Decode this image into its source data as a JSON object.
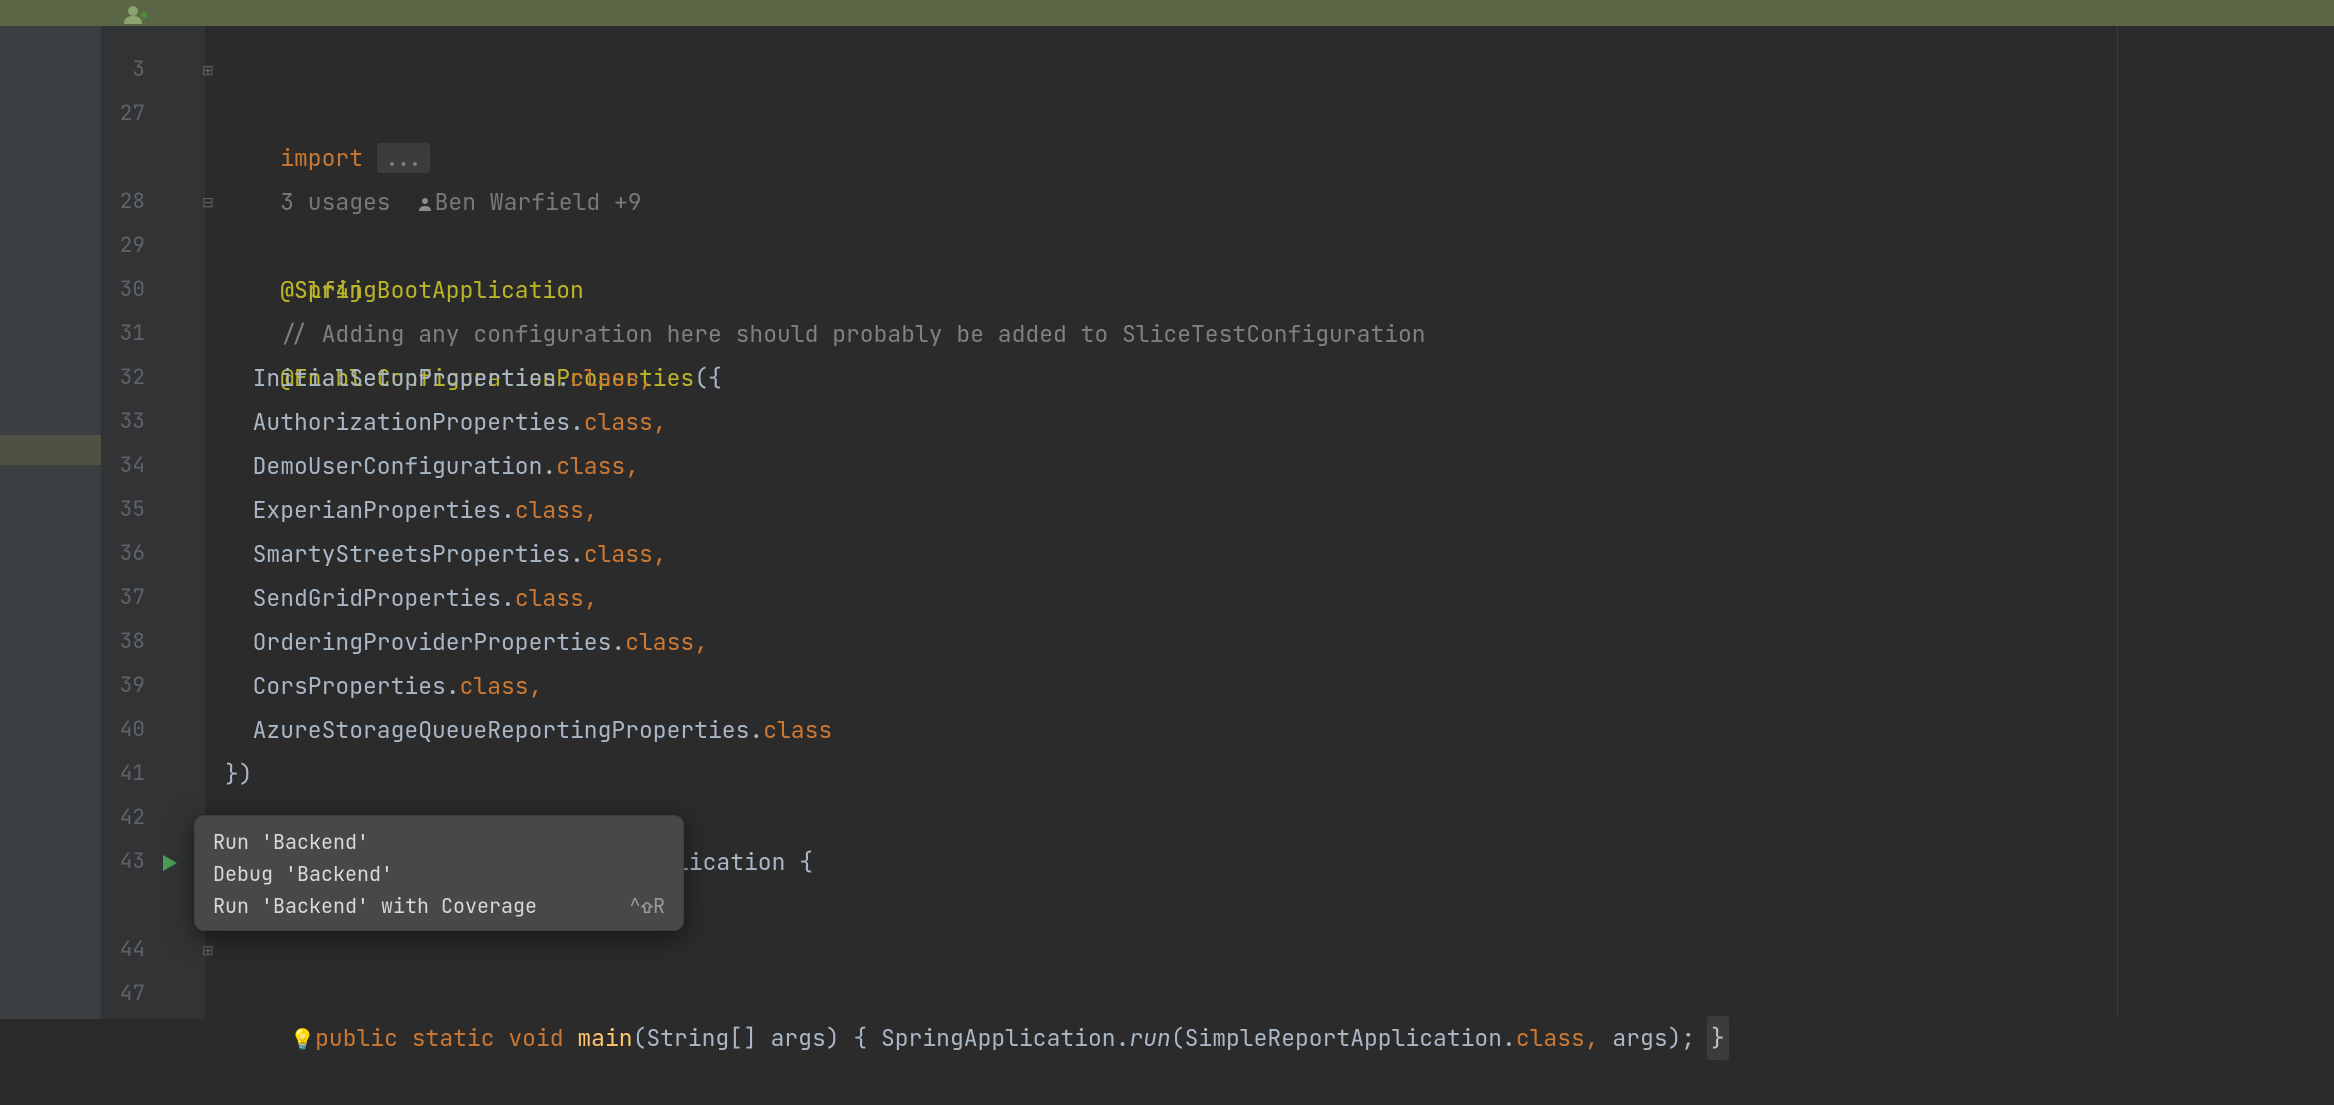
{
  "toolbar": {
    "avatar_icon": "avatar"
  },
  "gutter": {
    "line_numbers": [
      "3",
      "27",
      "28",
      "29",
      "30",
      "31",
      "32",
      "33",
      "34",
      "35",
      "36",
      "37",
      "38",
      "39",
      "40",
      "41",
      "42",
      "43",
      "44",
      "47"
    ]
  },
  "lens": {
    "usages": "3 usages",
    "author": "Ben Warfield +9"
  },
  "code": {
    "l3_import": "import",
    "l3_ellipsis": "...",
    "l28": "@Slf4j",
    "l29": "@SpringBootApplication",
    "l30": "// Adding any configuration here should probably be added to SliceTestConfiguration",
    "l31a": "@EnableConfigurationProperties",
    "l31b": "({",
    "l32a": "  InitialSetupProperties.",
    "l32b": "class,",
    "l33a": "  AuthorizationProperties.",
    "l33b": "class,",
    "l34a": "  DemoUserConfiguration.",
    "l34b": "class,",
    "l35a": "  ExperianProperties.",
    "l35b": "class,",
    "l36a": "  SmartyStreetsProperties.",
    "l36b": "class,",
    "l37a": "  SendGridProperties.",
    "l37b": "class,",
    "l38a": "  OrderingProviderProperties.",
    "l38b": "class,",
    "l39a": "  CorsProperties.",
    "l39b": "class,",
    "l40a": "  AzureStorageQueueReportingProperties.",
    "l40b": "class",
    "l41": "})",
    "l43_tail": "lication {",
    "l44_public": "public",
    "l44_static": "static",
    "l44_void": "void",
    "l44_main": "main",
    "l44_args": "(String[] args) { SpringApplication.",
    "l44_run": "run",
    "l44_paren_open": "(",
    "l44_cls": "SimpleReportApplication.",
    "l44_classkw": "class,",
    "l44_tail": " args); ",
    "l44_brace_close": "}"
  },
  "menu": {
    "run": "Run 'Backend'",
    "debug": "Debug 'Backend'",
    "coverage": "Run 'Backend' with Coverage",
    "coverage_sc": "^⇧R"
  }
}
